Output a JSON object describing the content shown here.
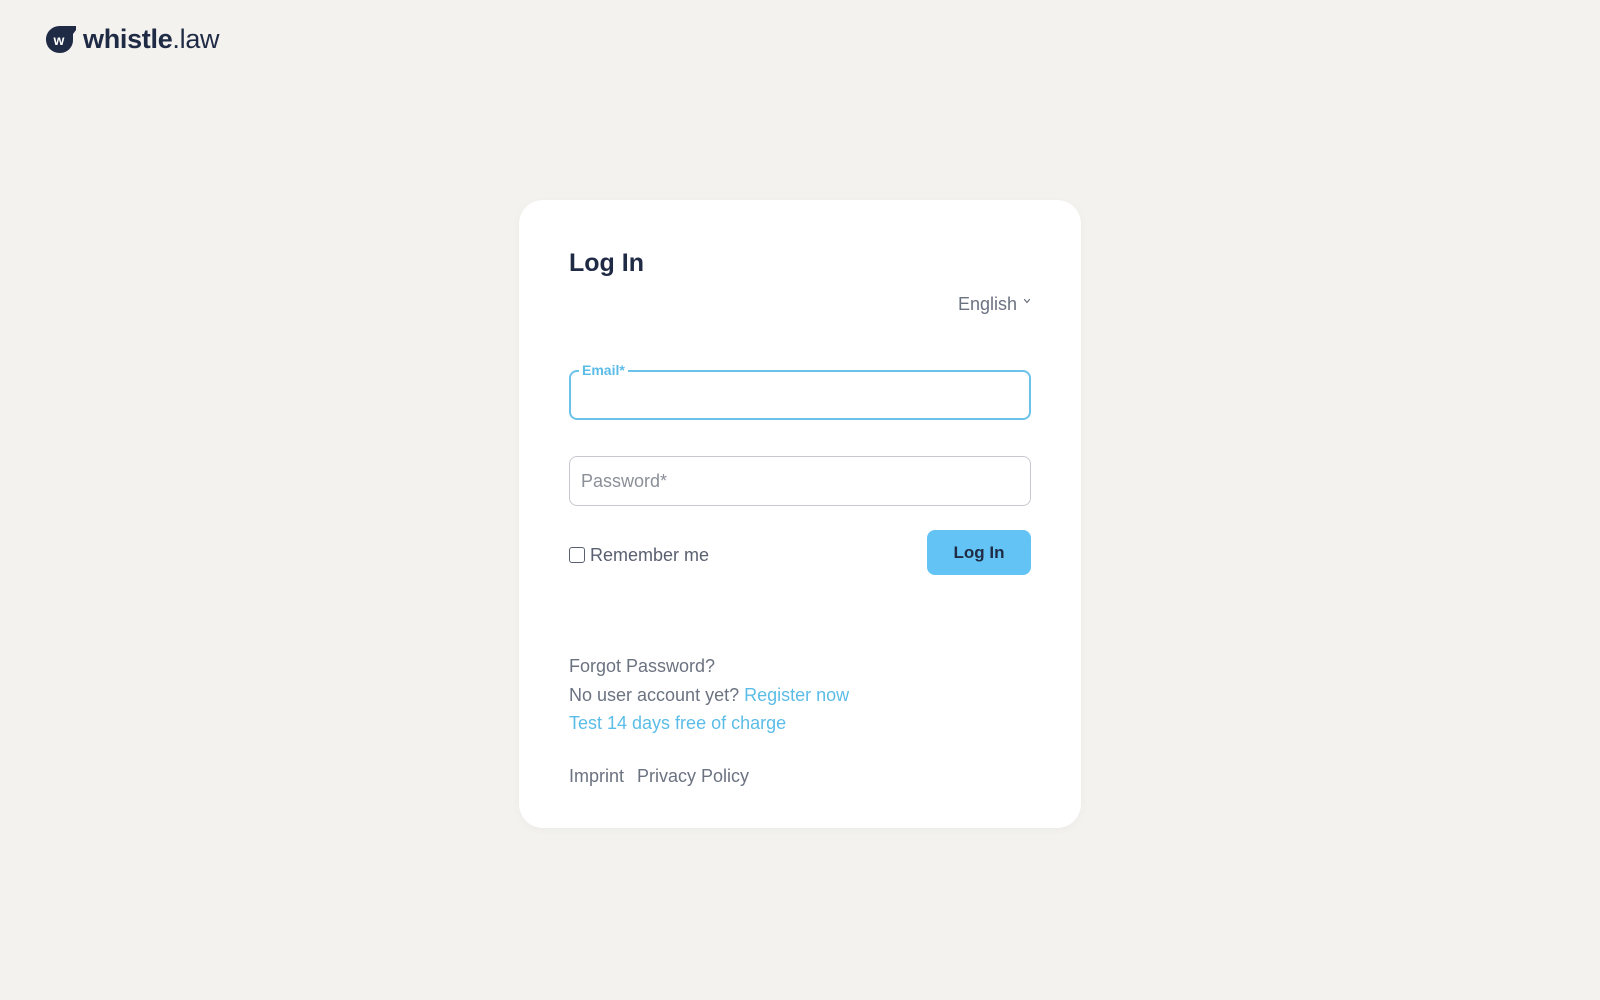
{
  "brand": {
    "name_bold": "whistle",
    "name_light": ".law",
    "mark_letter": "w",
    "color": "#1f2a44"
  },
  "login": {
    "title": "Log In",
    "language": "English",
    "email_label": "Email*",
    "email_value": "",
    "password_placeholder": "Password*",
    "remember_label": "Remember me",
    "remember_checked": false,
    "submit_label": "Log In",
    "forgot_password": "Forgot Password?",
    "no_account_text": "No user account yet?",
    "register_link": "Register now",
    "trial_link": "Test 14 days free of charge"
  },
  "footer": {
    "imprint": "Imprint",
    "privacy": "Privacy Policy"
  },
  "colors": {
    "background": "#f3f2ef",
    "card": "#ffffff",
    "accent": "#5bbde7",
    "button": "#63c3f4",
    "text": "#1f2a44",
    "muted": "#6b7280"
  },
  "icons": {
    "logo": "whistle-logo-icon",
    "language_toggle": "chevron-down-icon"
  }
}
